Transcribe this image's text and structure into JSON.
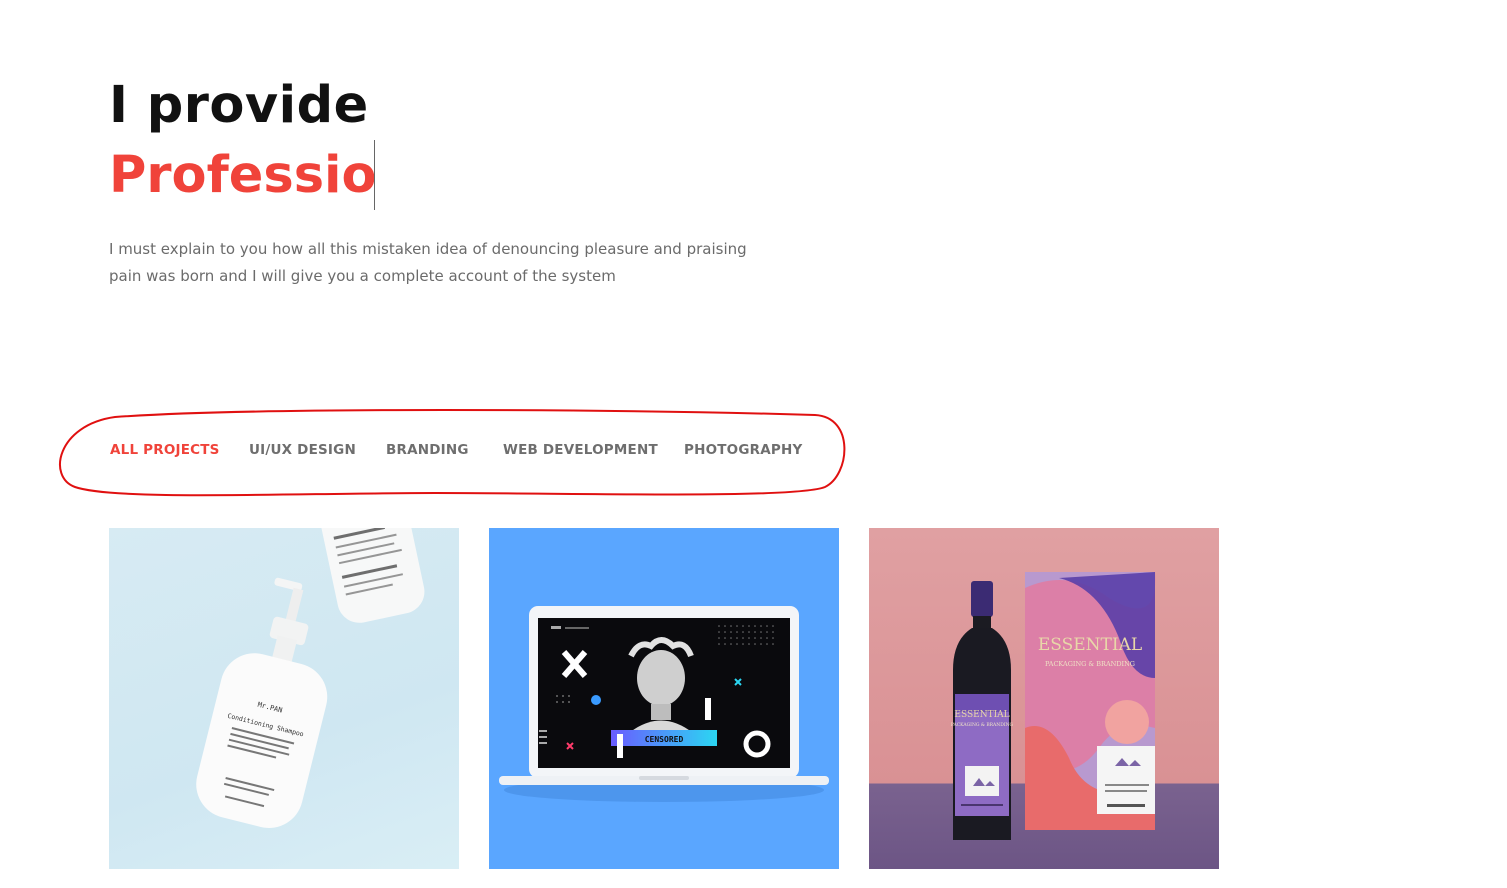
{
  "hero": {
    "line1": "I provide",
    "line2": "Professio"
  },
  "description": "I must explain to you how all this mistaken idea of denouncing pleasure and praising pain was born and I will give you a complete account of the system",
  "filters": [
    {
      "label": "ALL PROJECTS",
      "active": true
    },
    {
      "label": "UI/UX DESIGN",
      "active": false
    },
    {
      "label": "BRANDING",
      "active": false
    },
    {
      "label": "WEB DEVELOPMENT",
      "active": false
    },
    {
      "label": "PHOTOGRAPHY",
      "active": false
    }
  ],
  "portfolio": [
    {
      "name": "shampoo-bottles",
      "product_text": "Mr.PAN",
      "subtitle": "Conditioning Shampoo"
    },
    {
      "name": "laptop-mockup",
      "screen_text": "CENSORED"
    },
    {
      "name": "wine-packaging",
      "brand": "ESSENTIAL",
      "tagline": "PACKAGING & BRANDING"
    }
  ],
  "colors": {
    "accent": "#f0433a",
    "text_dark": "#111111",
    "text_muted": "#6b6b6b",
    "annotation": "#e01010"
  }
}
